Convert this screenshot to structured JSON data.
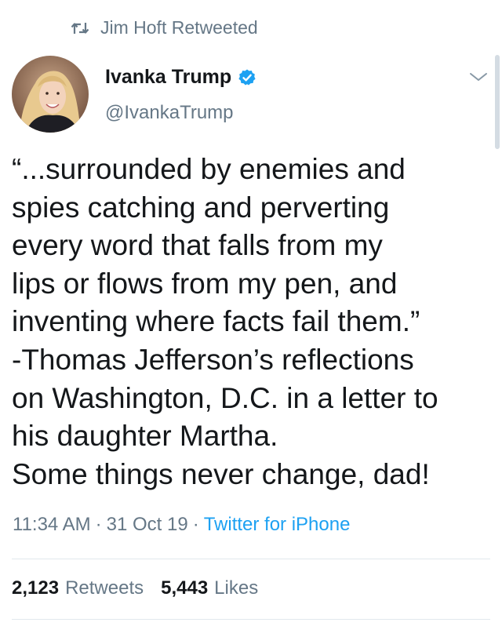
{
  "retweet": {
    "icon": "retweet-icon",
    "text": "Jim Hoft Retweeted"
  },
  "author": {
    "name": "Ivanka Trump",
    "handle": "@IvankaTrump",
    "verified_icon": "verified-badge-icon",
    "avatar": "avatar-photo"
  },
  "tweet": {
    "lines": [
      "“...surrounded by enemies and",
      "spies catching and perverting",
      "every word that falls from my",
      "lips or flows from my pen, and",
      "inventing where facts fail them.”",
      "-Thomas Jefferson’s reflections",
      "on Washington, D.C. in a letter to",
      "his daughter Martha.",
      "Some things never change, dad!"
    ]
  },
  "meta": {
    "time": "11:34 AM",
    "date": "31 Oct 19",
    "separator": "·",
    "source": "Twitter for iPhone"
  },
  "stats": {
    "retweets_count": "2,123",
    "retweets_label": "Retweets",
    "likes_count": "5,443",
    "likes_label": "Likes"
  },
  "colors": {
    "text_primary": "#14171a",
    "text_secondary": "#657786",
    "link_blue": "#1da1f2",
    "divider": "#e1e8ed"
  }
}
